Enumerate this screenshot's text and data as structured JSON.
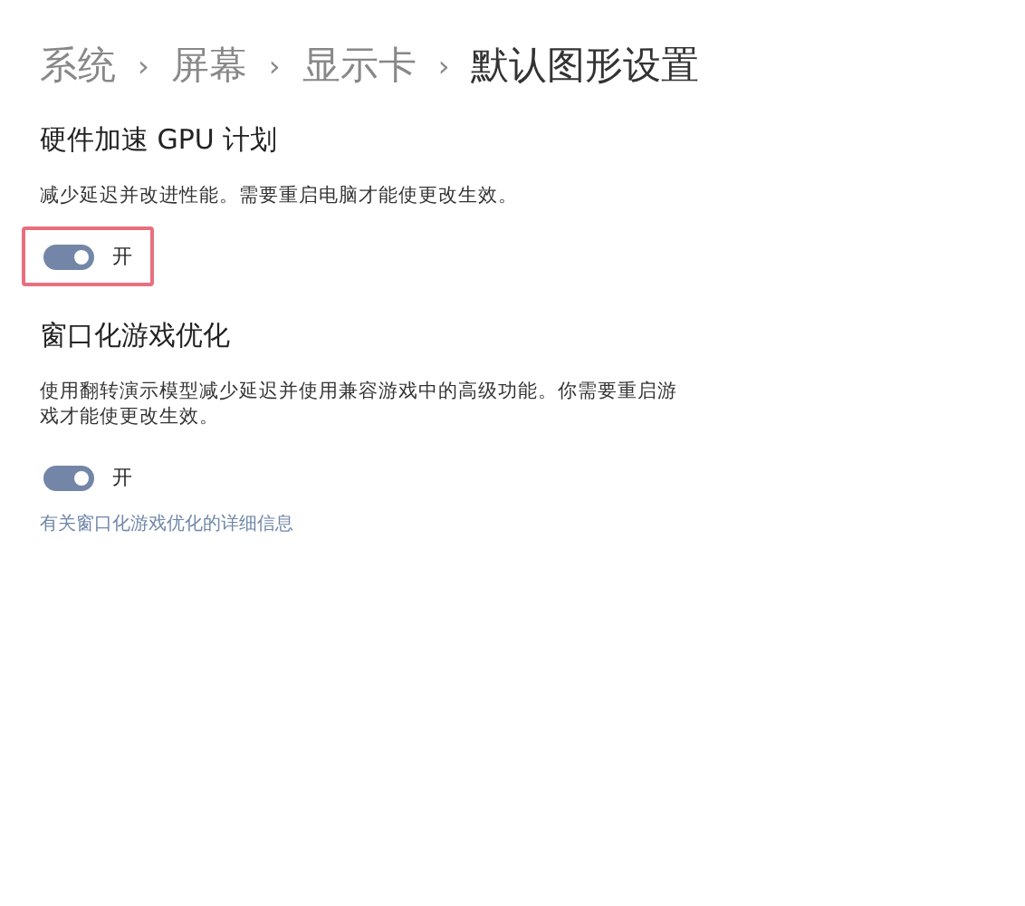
{
  "breadcrumb": [
    {
      "label": "系统",
      "current": false
    },
    {
      "label": "屏幕",
      "current": false
    },
    {
      "label": "显示卡",
      "current": false
    },
    {
      "label": "默认图形设置",
      "current": true
    }
  ],
  "breadcrumb_separator": "›",
  "sections": [
    {
      "title": "硬件加速 GPU 计划",
      "description": "减少延迟并改进性能。需要重启电脑才能使更改生效。",
      "toggle": {
        "on": true,
        "label": "开"
      },
      "highlighted": true
    },
    {
      "title": "窗口化游戏优化",
      "description": "使用翻转演示模型减少延迟并使用兼容游戏中的高级功能。你需要重启游戏才能使更改生效。",
      "toggle": {
        "on": true,
        "label": "开"
      },
      "highlighted": false,
      "link": "有关窗口化游戏优化的详细信息"
    }
  ]
}
